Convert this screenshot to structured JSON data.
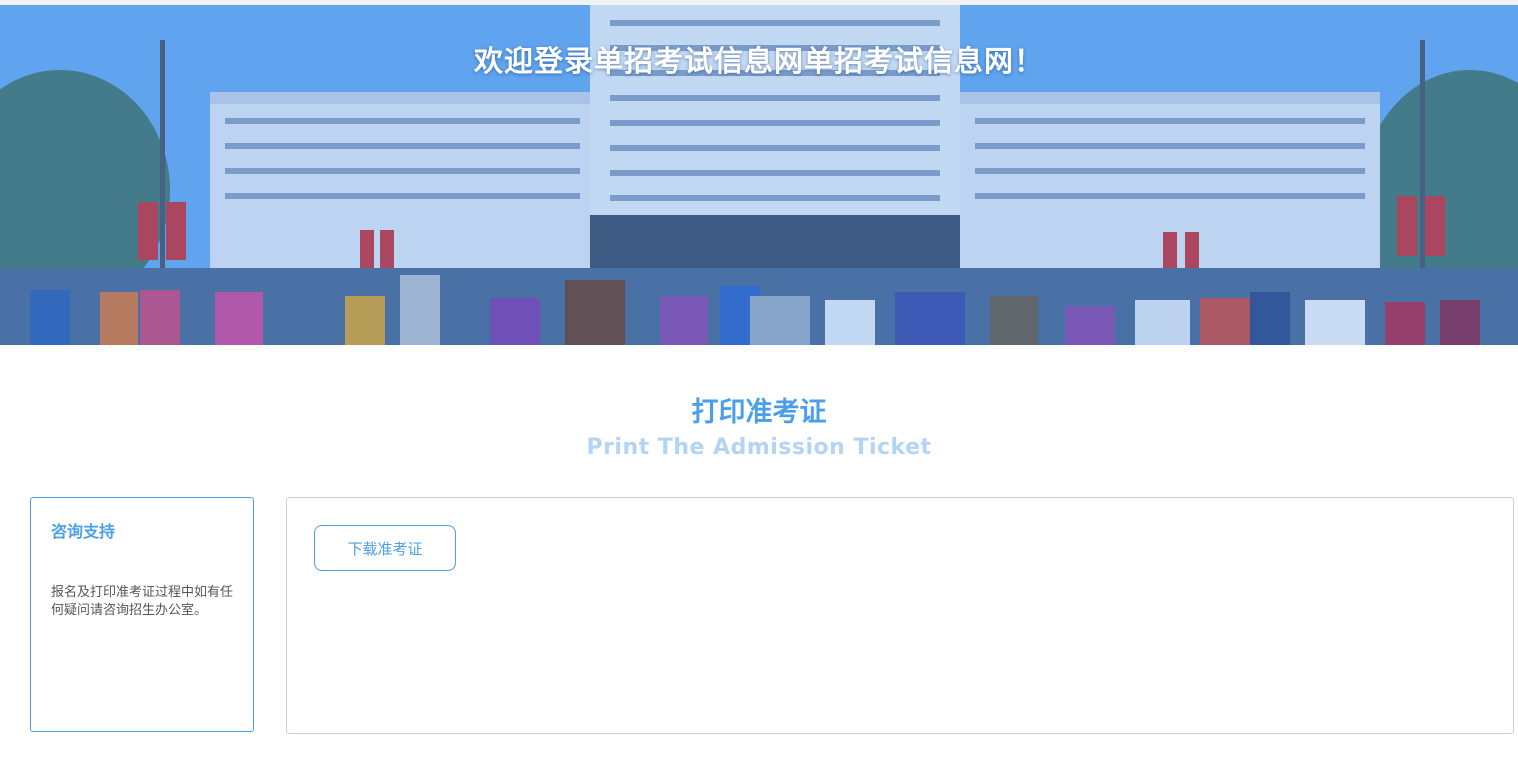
{
  "banner": {
    "title": "欢迎登录单招考试信息网单招考试信息网！",
    "image_alt": "campus-building-students-photo"
  },
  "section": {
    "title": "打印准考证",
    "subtitle": "Print The Admission Ticket"
  },
  "support": {
    "title": "咨询支持",
    "text": "报名及打印准考证过程中如有任何疑问请咨询招生办公室。"
  },
  "main": {
    "download_label": "下载准考证"
  },
  "colors": {
    "accent": "#4a9fe8",
    "subtitle": "#b3d4f3",
    "border": "#cfcfcf"
  }
}
